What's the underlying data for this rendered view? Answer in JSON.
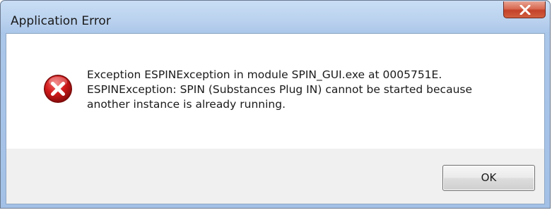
{
  "window": {
    "title": "Application Error"
  },
  "message": {
    "lines": [
      "Exception ESPINException in module SPIN_GUI.exe at 0005751E.",
      "ESPINException: SPIN (Substances Plug IN) cannot be started because",
      "another instance is already running."
    ]
  },
  "buttons": {
    "ok_label": "OK"
  },
  "icons": {
    "close": "close-icon",
    "error": "error-icon"
  },
  "colors": {
    "close_button": "#c3422a",
    "error_icon": "#d11a1a",
    "titlebar": "#b9d1ee"
  }
}
